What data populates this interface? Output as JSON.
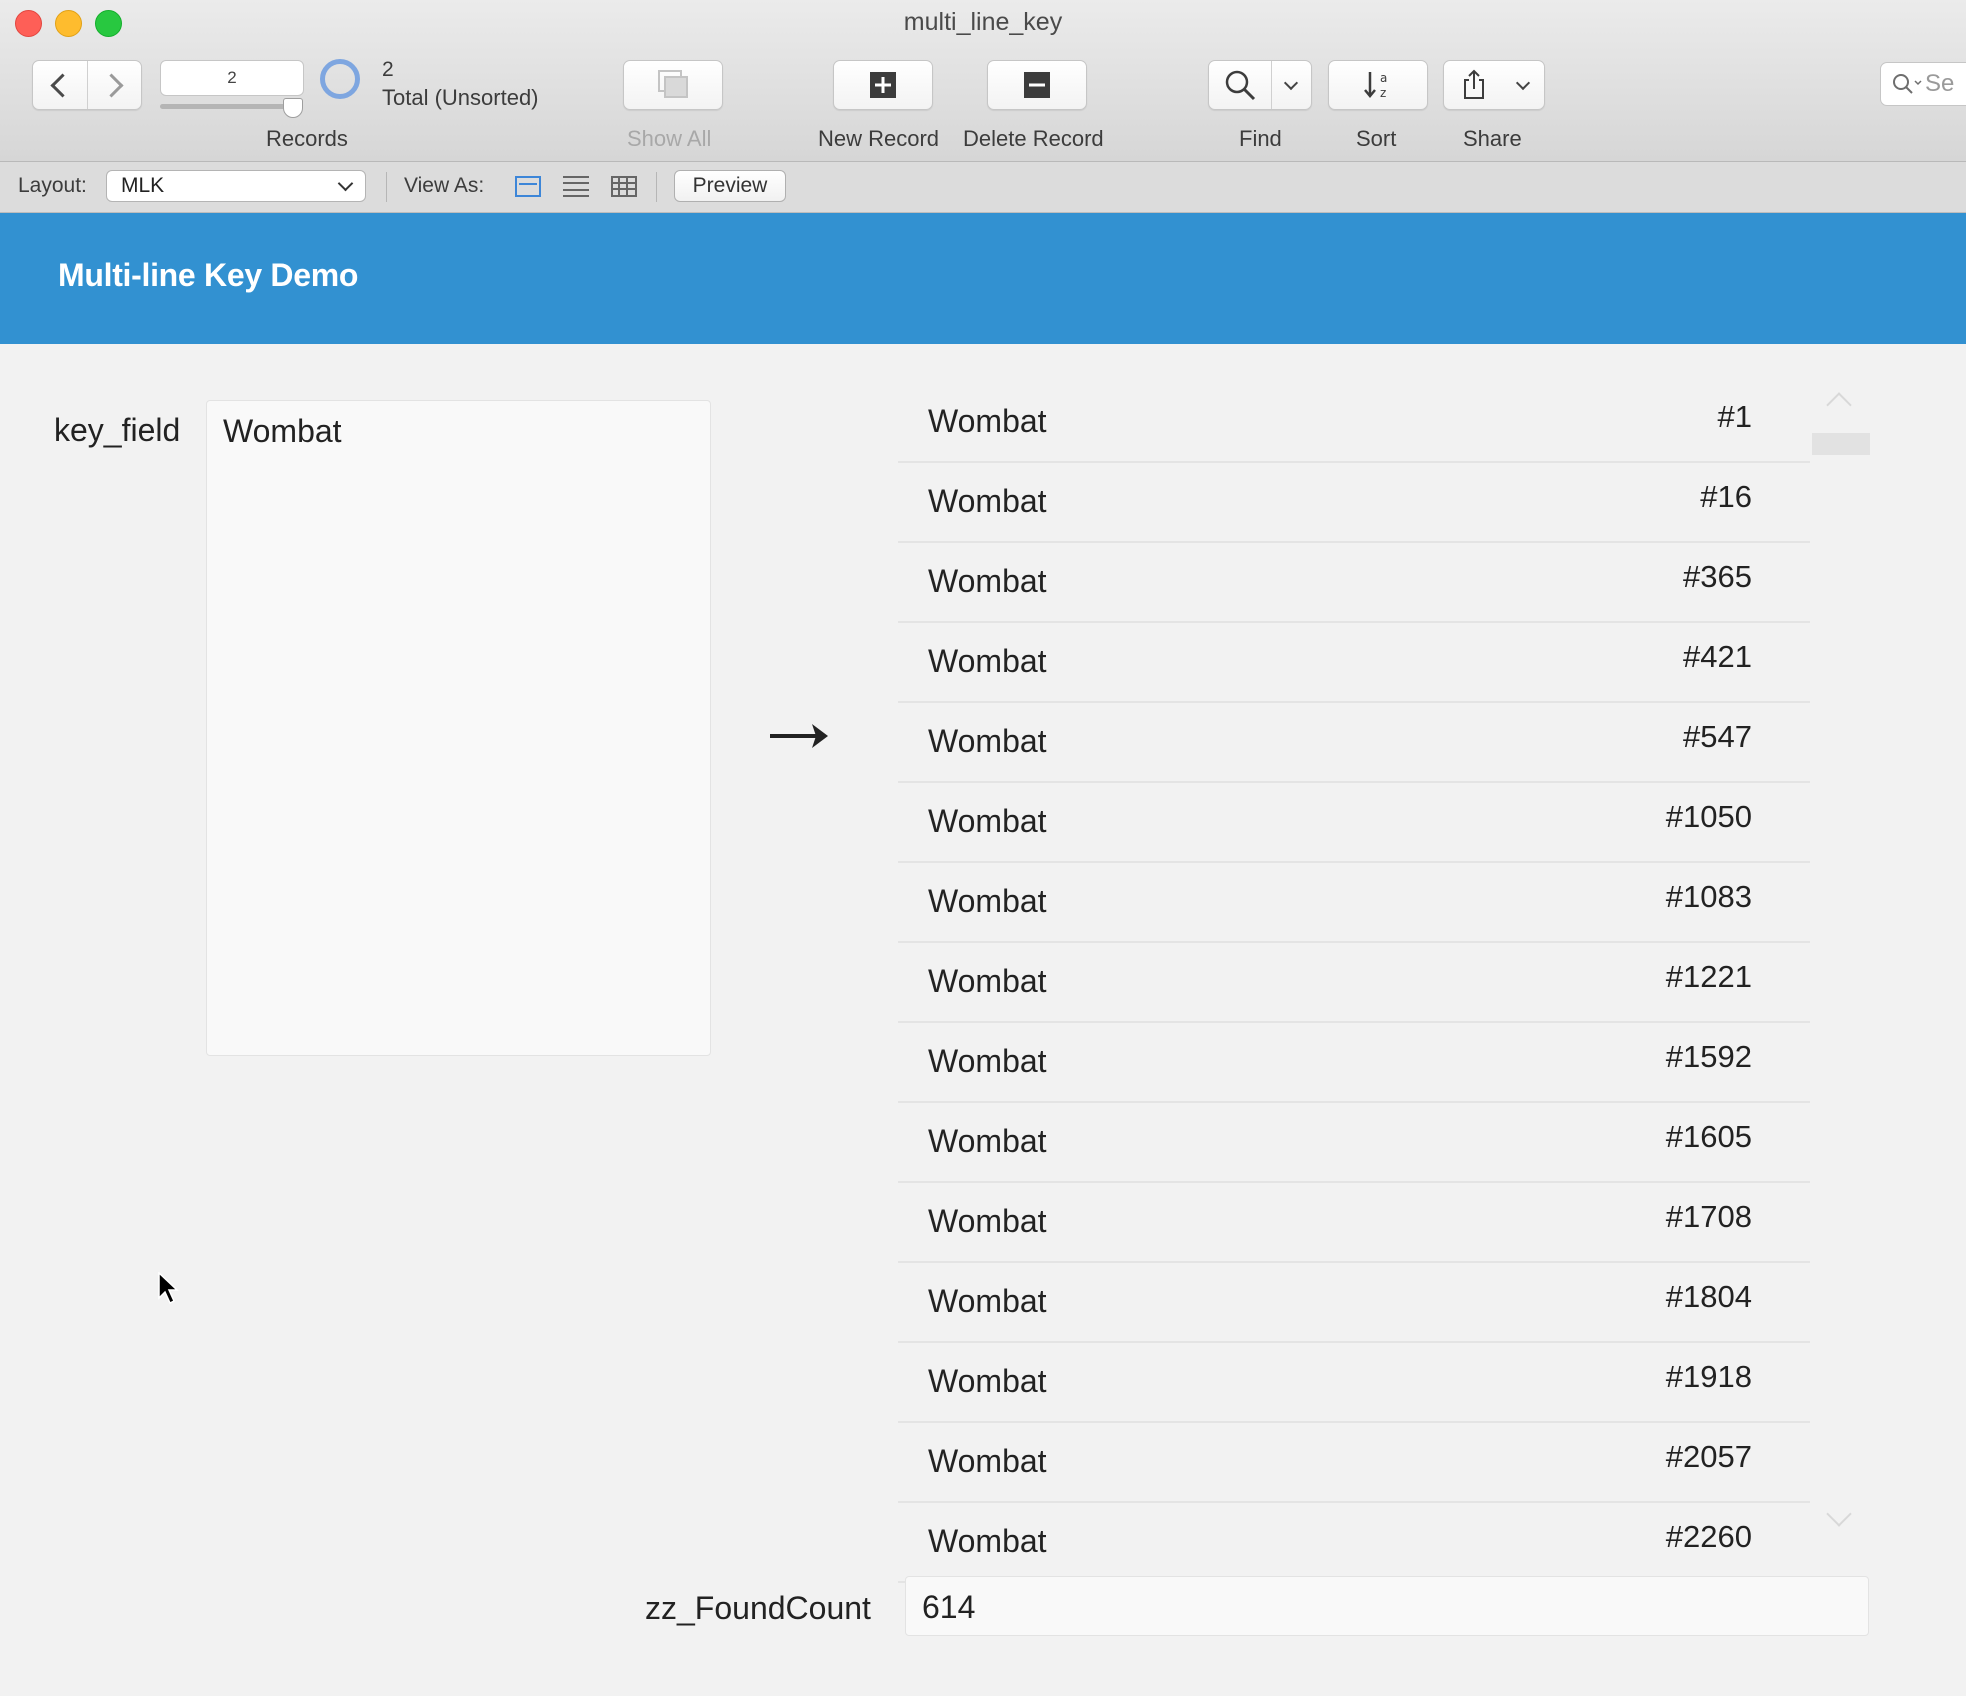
{
  "window": {
    "title": "multi_line_key"
  },
  "toolbar": {
    "record_number": "2",
    "found_count": "2",
    "total_status": "Total (Unsorted)",
    "records_label": "Records",
    "show_all_label": "Show All",
    "new_record_label": "New Record",
    "delete_record_label": "Delete Record",
    "find_label": "Find",
    "sort_label": "Sort",
    "share_label": "Share",
    "search_placeholder": "Se"
  },
  "layout_bar": {
    "layout_label": "Layout:",
    "layout_value": "MLK",
    "view_as_label": "View As:",
    "preview_label": "Preview"
  },
  "header": {
    "title": "Multi-line Key Demo"
  },
  "form": {
    "key_field_label": "key_field",
    "key_field_value": "Wombat",
    "found_count_label": "zz_FoundCount",
    "found_count_value": "614"
  },
  "portal": {
    "rows": [
      {
        "name": "Wombat",
        "id": "#1"
      },
      {
        "name": "Wombat",
        "id": "#16"
      },
      {
        "name": "Wombat",
        "id": "#365"
      },
      {
        "name": "Wombat",
        "id": "#421"
      },
      {
        "name": "Wombat",
        "id": "#547"
      },
      {
        "name": "Wombat",
        "id": "#1050"
      },
      {
        "name": "Wombat",
        "id": "#1083"
      },
      {
        "name": "Wombat",
        "id": "#1221"
      },
      {
        "name": "Wombat",
        "id": "#1592"
      },
      {
        "name": "Wombat",
        "id": "#1605"
      },
      {
        "name": "Wombat",
        "id": "#1708"
      },
      {
        "name": "Wombat",
        "id": "#1804"
      },
      {
        "name": "Wombat",
        "id": "#1918"
      },
      {
        "name": "Wombat",
        "id": "#2057"
      },
      {
        "name": "Wombat",
        "id": "#2260"
      }
    ]
  },
  "colors": {
    "header_band": "#3291d1",
    "accent_blue": "#3d86d8",
    "close": "#fe5f57",
    "minimize": "#febc2e",
    "maximize": "#28c840"
  }
}
